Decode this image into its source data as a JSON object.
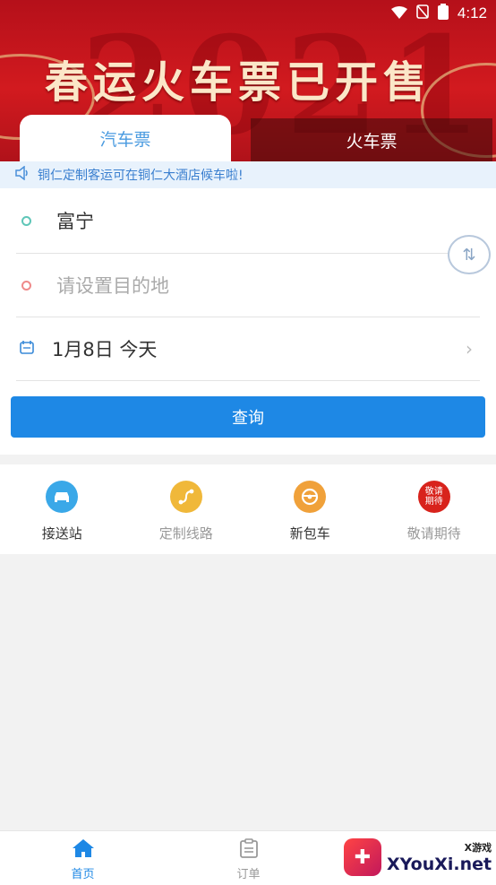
{
  "status_bar": {
    "time": "4:12"
  },
  "banner": {
    "year": "2021",
    "headline": "春运火车票已开售"
  },
  "tabs": [
    {
      "label": "汽车票"
    },
    {
      "label": "火车票"
    }
  ],
  "notice": {
    "text": "铜仁定制客运可在铜仁大酒店候车啦!"
  },
  "form": {
    "from": "富宁",
    "to_placeholder": "请设置目的地",
    "date": "1月8日 今天",
    "query_label": "查询"
  },
  "services": [
    {
      "label": "接送站",
      "icon": "car-icon",
      "color": "#3aa8e8"
    },
    {
      "label": "定制线路",
      "icon": "route-icon",
      "color": "#f0b83a"
    },
    {
      "label": "新包车",
      "icon": "steering-wheel-icon",
      "color": "#f0a13a"
    },
    {
      "label": "敬请期待",
      "icon": "coming-soon-badge",
      "badge_text": "敬请期待",
      "color": "#d8231c"
    }
  ],
  "bottom_nav": [
    {
      "label": "首页",
      "icon": "home-icon"
    },
    {
      "label": "订单",
      "icon": "order-icon"
    }
  ],
  "watermark": {
    "small": "X游戏",
    "big": "XYouXi.net"
  }
}
